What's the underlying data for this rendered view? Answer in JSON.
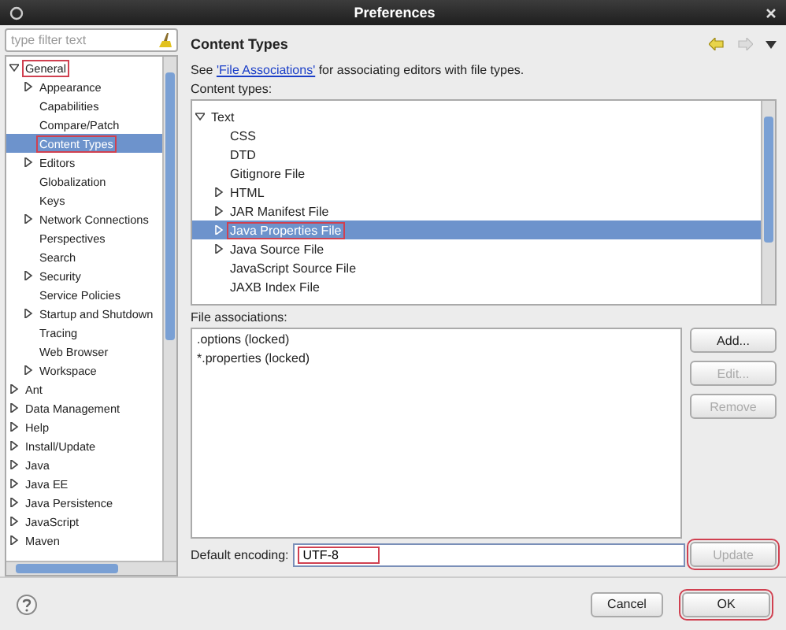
{
  "window": {
    "title": "Preferences"
  },
  "filter": {
    "placeholder": "type filter text"
  },
  "tree": [
    {
      "label": "General",
      "expandable": true,
      "expanded": true,
      "selected": false,
      "annotated": true,
      "children": [
        {
          "label": "Appearance",
          "expandable": true,
          "expanded": false,
          "selected": false,
          "annotated": false
        },
        {
          "label": "Capabilities",
          "expandable": false,
          "selected": false,
          "annotated": false
        },
        {
          "label": "Compare/Patch",
          "expandable": false,
          "selected": false,
          "annotated": false
        },
        {
          "label": "Content Types",
          "expandable": false,
          "selected": true,
          "annotated": true
        },
        {
          "label": "Editors",
          "expandable": true,
          "expanded": false,
          "selected": false,
          "annotated": false
        },
        {
          "label": "Globalization",
          "expandable": false,
          "selected": false,
          "annotated": false
        },
        {
          "label": "Keys",
          "expandable": false,
          "selected": false,
          "annotated": false
        },
        {
          "label": "Network Connections",
          "expandable": true,
          "expanded": false,
          "selected": false,
          "annotated": false
        },
        {
          "label": "Perspectives",
          "expandable": false,
          "selected": false,
          "annotated": false
        },
        {
          "label": "Search",
          "expandable": false,
          "selected": false,
          "annotated": false
        },
        {
          "label": "Security",
          "expandable": true,
          "expanded": false,
          "selected": false,
          "annotated": false
        },
        {
          "label": "Service Policies",
          "expandable": false,
          "selected": false,
          "annotated": false
        },
        {
          "label": "Startup and Shutdown",
          "expandable": true,
          "expanded": false,
          "selected": false,
          "annotated": false
        },
        {
          "label": "Tracing",
          "expandable": false,
          "selected": false,
          "annotated": false
        },
        {
          "label": "Web Browser",
          "expandable": false,
          "selected": false,
          "annotated": false
        },
        {
          "label": "Workspace",
          "expandable": true,
          "expanded": false,
          "selected": false,
          "annotated": false
        }
      ]
    },
    {
      "label": "Ant",
      "expandable": true,
      "expanded": false,
      "selected": false,
      "annotated": false
    },
    {
      "label": "Data Management",
      "expandable": true,
      "expanded": false,
      "selected": false,
      "annotated": false
    },
    {
      "label": "Help",
      "expandable": true,
      "expanded": false,
      "selected": false,
      "annotated": false
    },
    {
      "label": "Install/Update",
      "expandable": true,
      "expanded": false,
      "selected": false,
      "annotated": false
    },
    {
      "label": "Java",
      "expandable": true,
      "expanded": false,
      "selected": false,
      "annotated": false
    },
    {
      "label": "Java EE",
      "expandable": true,
      "expanded": false,
      "selected": false,
      "annotated": false
    },
    {
      "label": "Java Persistence",
      "expandable": true,
      "expanded": false,
      "selected": false,
      "annotated": false
    },
    {
      "label": "JavaScript",
      "expandable": true,
      "expanded": false,
      "selected": false,
      "annotated": false
    },
    {
      "label": "Maven",
      "expandable": true,
      "expanded": false,
      "selected": false,
      "annotated": false
    }
  ],
  "page": {
    "title": "Content Types",
    "intro_before": "See ",
    "intro_link": "'File Associations'",
    "intro_after": " for associating editors with file types.",
    "content_types_label": "Content types:"
  },
  "content_types": [
    {
      "label": "Text",
      "expandable": true,
      "expanded": true,
      "selected": false,
      "annotated": false,
      "children": [
        {
          "label": "CSS",
          "expandable": false,
          "selected": false,
          "annotated": false
        },
        {
          "label": "DTD",
          "expandable": false,
          "selected": false,
          "annotated": false
        },
        {
          "label": "Gitignore File",
          "expandable": false,
          "selected": false,
          "annotated": false
        },
        {
          "label": "HTML",
          "expandable": true,
          "expanded": false,
          "selected": false,
          "annotated": false
        },
        {
          "label": "JAR Manifest File",
          "expandable": true,
          "expanded": false,
          "selected": false,
          "annotated": false
        },
        {
          "label": "Java Properties File",
          "expandable": true,
          "expanded": false,
          "selected": true,
          "annotated": true
        },
        {
          "label": "Java Source File",
          "expandable": true,
          "expanded": false,
          "selected": false,
          "annotated": false
        },
        {
          "label": "JavaScript Source File",
          "expandable": false,
          "selected": false,
          "annotated": false
        },
        {
          "label": "JAXB Index File",
          "expandable": false,
          "selected": false,
          "annotated": false
        }
      ]
    }
  ],
  "file_associations": {
    "label": "File associations:",
    "items": [
      ".options (locked)",
      "*.properties (locked)"
    ],
    "buttons": [
      {
        "label": "Add...",
        "disabled": false
      },
      {
        "label": "Edit...",
        "disabled": true
      },
      {
        "label": "Remove",
        "disabled": true
      }
    ]
  },
  "encoding": {
    "label": "Default encoding:",
    "value": "UTF-8",
    "annotated": true,
    "button": {
      "label": "Update",
      "disabled": true,
      "annotated": true
    }
  },
  "footer": {
    "buttons": [
      {
        "label": "Cancel",
        "annotated": false
      },
      {
        "label": "OK",
        "annotated": true
      }
    ]
  }
}
